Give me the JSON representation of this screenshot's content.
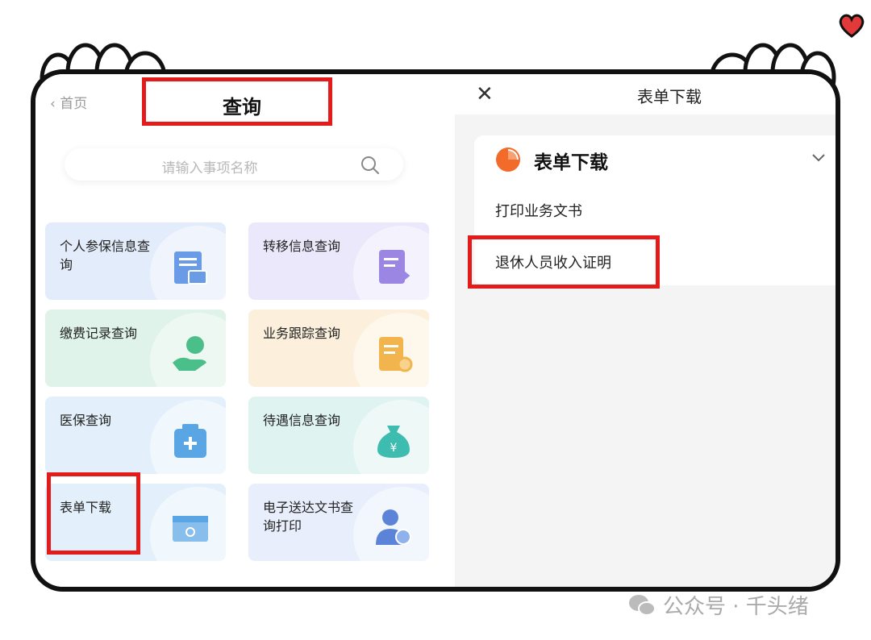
{
  "left": {
    "back_label": "首页",
    "title": "查询",
    "search_placeholder": "请输入事项名称",
    "cards": [
      {
        "label": "个人参保信息查询",
        "icon": "insurance-doc-icon",
        "bg": "#e3ecfb",
        "accent": "#6a9be6"
      },
      {
        "label": "转移信息查询",
        "icon": "transfer-doc-icon",
        "bg": "#ece8fb",
        "accent": "#9b86e4"
      },
      {
        "label": "缴费记录查询",
        "icon": "payment-hand-icon",
        "bg": "#dff3ea",
        "accent": "#4bbf8a"
      },
      {
        "label": "业务跟踪查询",
        "icon": "tracking-doc-icon",
        "bg": "#fcf0dc",
        "accent": "#f2b44d"
      },
      {
        "label": "医保查询",
        "icon": "medical-kit-icon",
        "bg": "#e3f0fb",
        "accent": "#5aa5e4"
      },
      {
        "label": "待遇信息查询",
        "icon": "money-bag-icon",
        "bg": "#dff3f1",
        "accent": "#3fbcb0"
      },
      {
        "label": "表单下载",
        "icon": "form-download-icon",
        "bg": "#e3f0fb",
        "accent": "#5aa5e4"
      },
      {
        "label": "电子送达文书查询打印",
        "icon": "person-print-icon",
        "bg": "#e8eefb",
        "accent": "#5b84d9"
      }
    ]
  },
  "right": {
    "close_label": "✕",
    "title": "表单下载",
    "section_title": "表单下载",
    "items": [
      "打印业务文书",
      "退休人员收入证明"
    ]
  },
  "watermark": "公众号 · 千头绪",
  "colors": {
    "highlight": "#e41b1b",
    "section_icon": "#f26b2a"
  }
}
